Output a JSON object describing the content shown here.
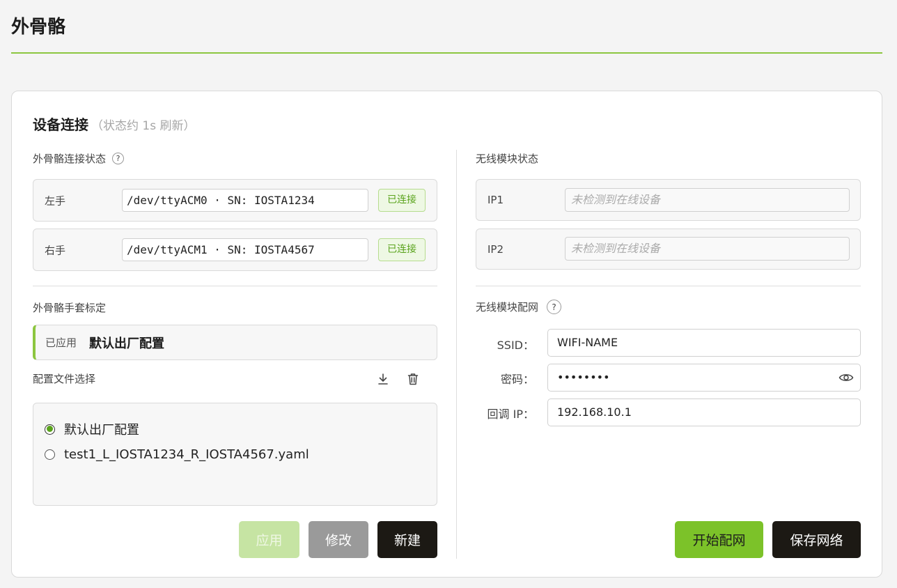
{
  "header": {
    "title": "外骨骼"
  },
  "card": {
    "title": "设备连接",
    "hint": "（状态约 1s 刷新）",
    "exo_status": {
      "label": "外骨骼连接状态",
      "help": "?",
      "rows": [
        {
          "label": "左手",
          "port": "/dev/ttyACM0 · SN: IOSTA1234",
          "status": "已连接"
        },
        {
          "label": "右手",
          "port": "/dev/ttyACM1 · SN: IOSTA4567",
          "status": "已连接"
        }
      ]
    },
    "wireless_status": {
      "label": "无线模块状态",
      "rows": [
        {
          "label": "IP1",
          "value": "未检测到在线设备"
        },
        {
          "label": "IP2",
          "value": "未检测到在线设备"
        }
      ]
    },
    "calibration": {
      "label": "外骨骼手套标定",
      "applied_label": "已应用",
      "applied_value": "默认出厂配置",
      "file_select_label": "配置文件选择",
      "download_icon": "download-icon",
      "delete_icon": "trash-icon",
      "files": [
        {
          "name": "默认出厂配置",
          "selected": true
        },
        {
          "name": "test1_L_IOSTA1234_R_IOSTA4567.yaml",
          "selected": false
        }
      ],
      "buttons": {
        "apply": "应用",
        "edit": "修改",
        "new": "新建"
      }
    },
    "network": {
      "label": "无线模块配网",
      "help": "?",
      "ssid_label": "SSID：",
      "ssid_value": "WIFI-NAME",
      "password_label": "密码：",
      "password_value": "••••••••",
      "callback_label": "回调 IP：",
      "callback_value": "192.168.10.1",
      "eye_icon": "eye-icon",
      "buttons": {
        "start": "开始配网",
        "save": "保存网络"
      }
    }
  },
  "colors": {
    "accent": "#8cc63f",
    "success_text": "#5aa31c",
    "dark_button": "#1c1914"
  }
}
